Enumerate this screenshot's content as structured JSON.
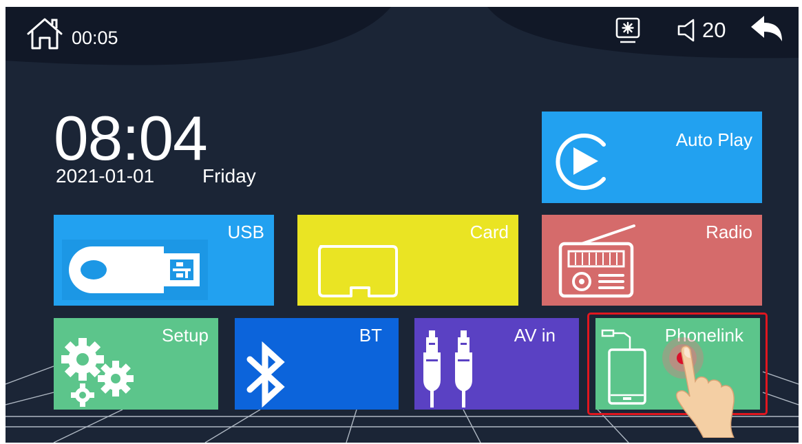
{
  "topbar": {
    "clock": "00:05",
    "volume_level": "20",
    "icons": [
      "home-icon",
      "brightness-icon",
      "volume-icon",
      "back-icon"
    ]
  },
  "home": {
    "time": "08:04",
    "date": "2021-01-01",
    "weekday": "Friday"
  },
  "tiles": {
    "autoplay": {
      "label": "Auto Play",
      "icon": "play-circle-icon",
      "color": "#22a1f0"
    },
    "usb": {
      "label": "USB",
      "icon": "usb-drive-icon",
      "color": "#22a1f0"
    },
    "card": {
      "label": "Card",
      "icon": "sd-card-icon",
      "color": "#eae423"
    },
    "radio": {
      "label": "Radio",
      "icon": "radio-icon",
      "color": "#d56b6b"
    },
    "setup": {
      "label": "Setup",
      "icon": "gears-icon",
      "color": "#5cc58b"
    },
    "bt": {
      "label": "BT",
      "icon": "bluetooth-icon",
      "color": "#0c64db"
    },
    "avin": {
      "label": "AV in",
      "icon": "av-connectors-icon",
      "color": "#5a41c3"
    },
    "phonelink": {
      "label": "Phonelink",
      "icon": "phone-cable-icon",
      "color": "#5cc58b"
    }
  },
  "highlight": {
    "target": "phonelink",
    "color": "#e0161f"
  }
}
